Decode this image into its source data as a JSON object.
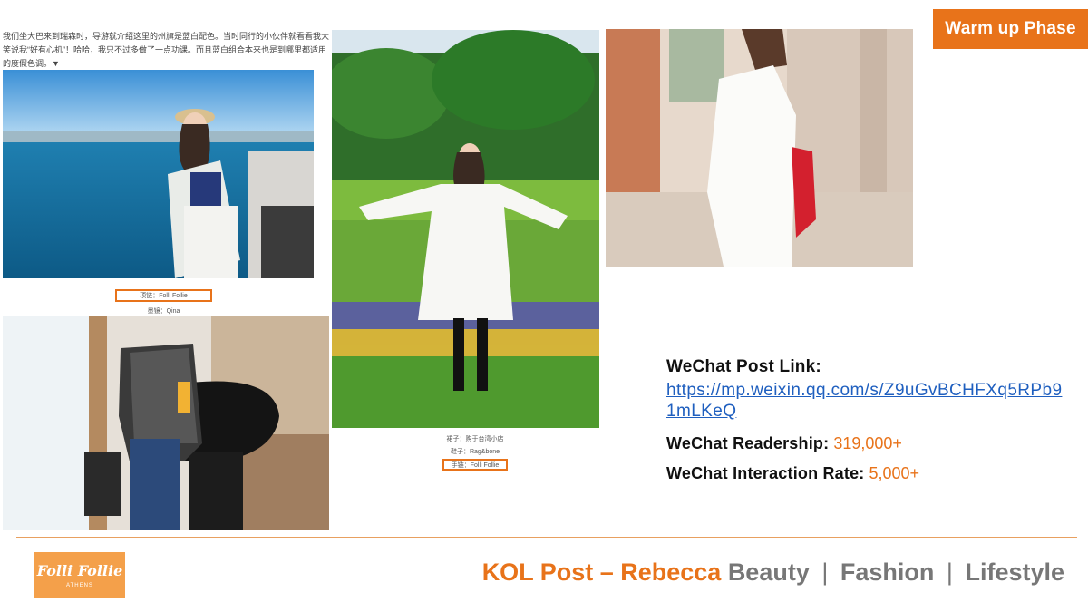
{
  "badge": {
    "label": "Warm up Phase"
  },
  "intro_text": "我们坐大巴来到瑞森时，导游就介绍这里的州旗是蓝白配色。当时同行的小伙伴就看看我大笑说我“好有心机”！哈哈，我只不过多做了一点功课。而且蓝白组合本来也是到哪里都适用的度假色调。▼",
  "photo1": {
    "caption_highlight": "项链：Folli Follie",
    "caption2": "墨镜：Qina"
  },
  "photo2": {
    "caption1": "裙子：购于台湾小店",
    "caption2": "鞋子：Rag&bone",
    "caption_highlight": "手链：Folli Follie"
  },
  "info": {
    "link_label": "WeChat Post Link:",
    "link_url": "https://mp.weixin.qq.com/s/Z9uGvBCHFXq5RPb91mLKeQ",
    "readership_label": "WeChat Readership:",
    "readership_value": "319,000+",
    "interaction_label": "WeChat Interaction Rate:",
    "interaction_value": "5,000+"
  },
  "logo": {
    "name": "Folli Follie",
    "city": "ATHENS"
  },
  "footer": {
    "kol": "KOL Post – Rebecca",
    "cat1": "Beauty",
    "cat2": "Fashion",
    "cat3": "Lifestyle",
    "separator": "|"
  },
  "colors": {
    "accent": "#e8731a",
    "link": "#1f5fbf",
    "logo_bg": "#f4a04a"
  }
}
